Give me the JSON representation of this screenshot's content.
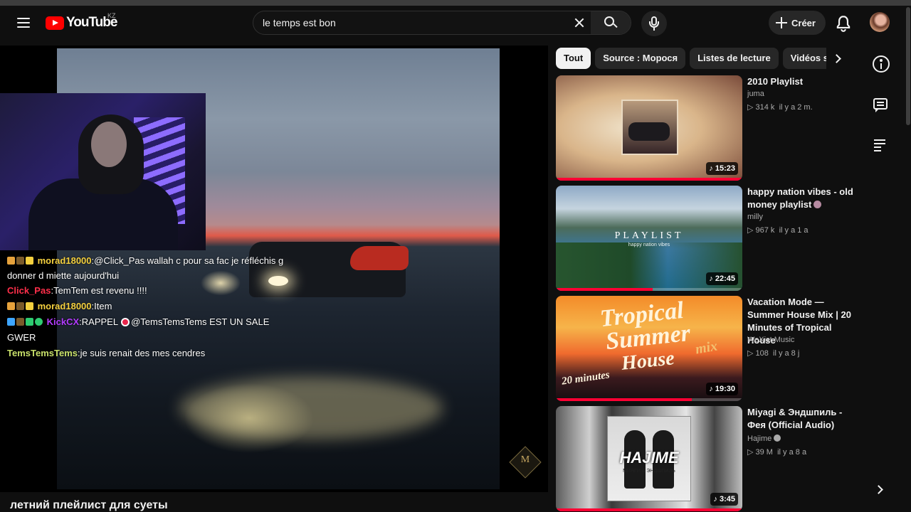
{
  "header": {
    "logo_text": "YouTube",
    "country_code": "KZ",
    "search_value": "le temps est bon",
    "create_label": "Créer",
    "icons": [
      "menu-icon",
      "close-icon",
      "search-icon",
      "microphone-icon",
      "plus-icon",
      "bell-icon",
      "avatar"
    ]
  },
  "player": {
    "video_title": "летний плейлист для суеты",
    "watermark_letter": "M",
    "chat": [
      {
        "user": "morad18000",
        "user_color": "#f4d03f",
        "message": "@Click_Pas wallah c pour sa fac je réfléchis g donner d miette aujourd'hui",
        "message_wrap": "donner d miette aujourd'hui",
        "message_first": "@Click_Pas wallah c pour sa fac je réfléchis g"
      },
      {
        "user": "Click_Pas",
        "user_color": "#ff2f4a",
        "message": "TemTem est revenu !!!!"
      },
      {
        "user": "morad18000",
        "user_color": "#f4d03f",
        "message": "Item"
      },
      {
        "user": "KickCX",
        "user_color": "#b33cff",
        "message_before_emote": "RAPPEL",
        "message_after_emote": "@TemsTemsTems EST UN SALE GWER"
      },
      {
        "user": "TemsTemsTems",
        "user_color": "#c8e06a",
        "message": "je suis renait des mes cendres"
      }
    ]
  },
  "chips": {
    "items": [
      "Tout",
      "Source : Морося",
      "Listes de lecture",
      "Vidéos sir"
    ],
    "active_index": 0
  },
  "recommendations": [
    {
      "title": "2010 Playlist",
      "channel": "juma",
      "views": "314 k",
      "age": "il y a 2 m.",
      "duration": "15:23",
      "progress": 1.0
    },
    {
      "title": "happy nation vibes - old money playlist",
      "channel": "milly",
      "views": "967 k",
      "age": "il y a 1 a",
      "duration": "22:45",
      "progress": 0.52,
      "thumb_word": "PLAYLIST",
      "thumb_sub": "happy nation vibes"
    },
    {
      "title": "Vacation Mode — Summer House Mix | 20 Minutes of Tropical House",
      "channel": "WeXist Music",
      "views": "108",
      "age": "il y a 8 j",
      "duration": "19:30",
      "progress": 0.73,
      "thumb_words": [
        "Tropical",
        "Summer",
        "House",
        "mix",
        "20 minutes"
      ]
    },
    {
      "title": "Miyagi & Эндшпиль - Фея (Official Audio)",
      "channel": "Hajime",
      "views": "39 M",
      "age": "il y a 8 a",
      "duration": "3:45",
      "progress": 1.0,
      "verified": true,
      "thumb_word": "HAJIME",
      "thumb_sub": "МИЯГИ & ЭНДШПИЛЬ"
    }
  ],
  "rail": {
    "icons": [
      "info-icon",
      "chat-icon",
      "queue-icon",
      "chevron-right-icon"
    ]
  },
  "colors": {
    "background": "#0f0f0f",
    "brand_red": "#ff0000",
    "progress_red": "#ff0033",
    "chip_bg": "#272727",
    "chip_active_bg": "#f1f1f1"
  }
}
